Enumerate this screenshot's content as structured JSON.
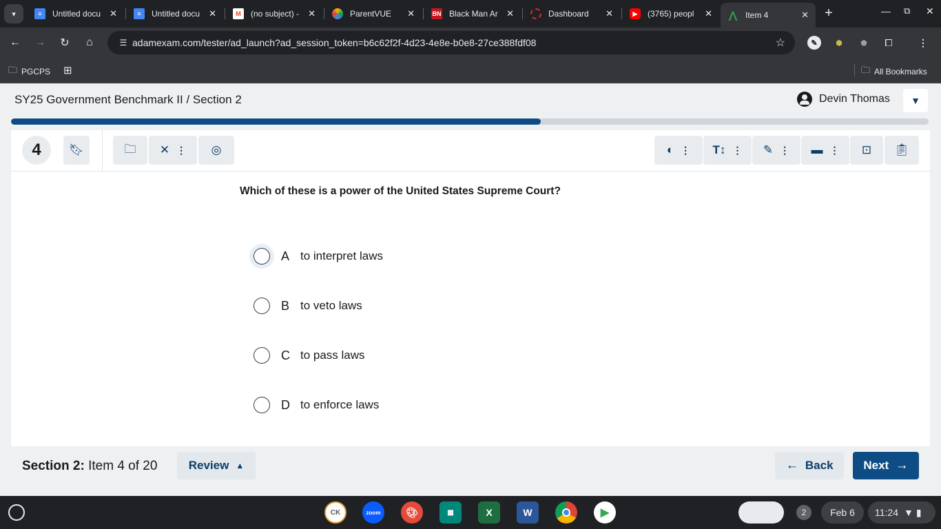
{
  "browser": {
    "tabs": [
      {
        "title": "Untitled docu",
        "icon": "docs-icon",
        "color": "#4285f4"
      },
      {
        "title": "Untitled docu",
        "icon": "docs-icon",
        "color": "#4285f4"
      },
      {
        "title": "(no subject) -",
        "icon": "gmail-icon",
        "color": "#ea4335"
      },
      {
        "title": "ParentVUE",
        "icon": "parentvue-icon",
        "color": "#f4b400"
      },
      {
        "title": "Black Man Ar",
        "icon": "bn-icon",
        "color": "#c4161c",
        "glyph": "BN"
      },
      {
        "title": "Dashboard",
        "icon": "dashboard-icon",
        "color": "#d93025"
      },
      {
        "title": "(3765) peopl",
        "icon": "youtube-icon",
        "color": "#ff0000"
      },
      {
        "title": "Item 4",
        "icon": "test-icon",
        "color": "#34a853"
      }
    ],
    "url": "adamexam.com/tester/ad_launch?ad_session_token=b6c62f2f-4d23-4e8e-b0e8-27ce388fdf08",
    "bookmarks": {
      "pgcps": "PGCPS",
      "all": "All Bookmarks"
    }
  },
  "test": {
    "title": "SY25 Government Benchmark II / Section 2",
    "user": "Devin Thomas",
    "progress_fraction": 0.577,
    "item_number": "4",
    "question": "Which of these is a power of the United States Supreme Court?",
    "choices": [
      {
        "letter": "A",
        "text": "to interpret laws"
      },
      {
        "letter": "B",
        "text": "to veto laws"
      },
      {
        "letter": "C",
        "text": "to pass laws"
      },
      {
        "letter": "D",
        "text": "to enforce laws"
      }
    ],
    "footer": {
      "section": "Section 2:",
      "item_of": "Item 4 of 20",
      "review": "Review",
      "back": "Back",
      "next": "Next"
    }
  },
  "shelf": {
    "notifications": "2",
    "date": "Feb 6",
    "time": "11:24"
  },
  "colors": {
    "primary": "#0e4c86",
    "progress_track": "#cfd5da"
  }
}
